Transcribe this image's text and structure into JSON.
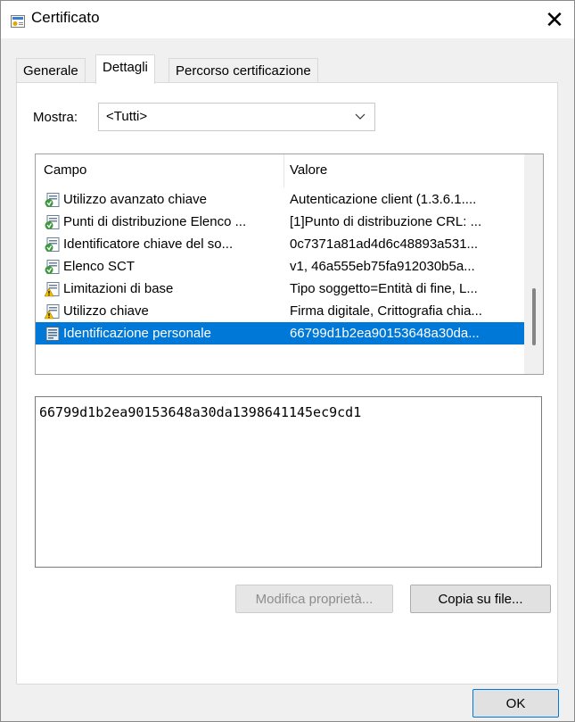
{
  "window": {
    "title": "Certificato",
    "close_glyph": "✕",
    "ok_label": "OK"
  },
  "tabs": [
    {
      "label": "Generale",
      "active": false
    },
    {
      "label": "Dettagli",
      "active": true
    },
    {
      "label": "Percorso certificazione",
      "active": false
    }
  ],
  "show": {
    "label": "Mostra:",
    "value": "<Tutti>"
  },
  "columns": {
    "field": "Campo",
    "value": "Valore"
  },
  "rows": [
    {
      "field": "Utilizzo avanzato chiave",
      "value": "Autenticazione client (1.3.6.1....",
      "icon": "extension-icon",
      "selected": false
    },
    {
      "field": "Punti di distribuzione Elenco ...",
      "value": "[1]Punto di distribuzione CRL: ...",
      "icon": "extension-icon",
      "selected": false
    },
    {
      "field": "Identificatore chiave del so...",
      "value": "0c7371a81ad4d6c48893a531...",
      "icon": "extension-icon",
      "selected": false
    },
    {
      "field": "Elenco SCT",
      "value": "v1, 46a555eb75fa912030b5a...",
      "icon": "extension-icon",
      "selected": false
    },
    {
      "field": "Limitazioni di base",
      "value": "Tipo soggetto=Entità di fine, L...",
      "icon": "critical-extension-icon",
      "selected": false
    },
    {
      "field": "Utilizzo chiave",
      "value": "Firma digitale, Crittografia chia...",
      "icon": "critical-extension-icon",
      "selected": false
    },
    {
      "field": "Identificazione personale",
      "value": "66799d1b2ea90153648a30da...",
      "icon": "property-icon",
      "selected": true
    }
  ],
  "detail_text": "66799d1b2ea90153648a30da1398641145ec9cd1",
  "buttons": {
    "edit_properties": "Modifica proprietà...",
    "copy_to_file": "Copia su file..."
  },
  "colors": {
    "selection": "#0078d7",
    "dialog_bg": "#f0f0f0"
  }
}
